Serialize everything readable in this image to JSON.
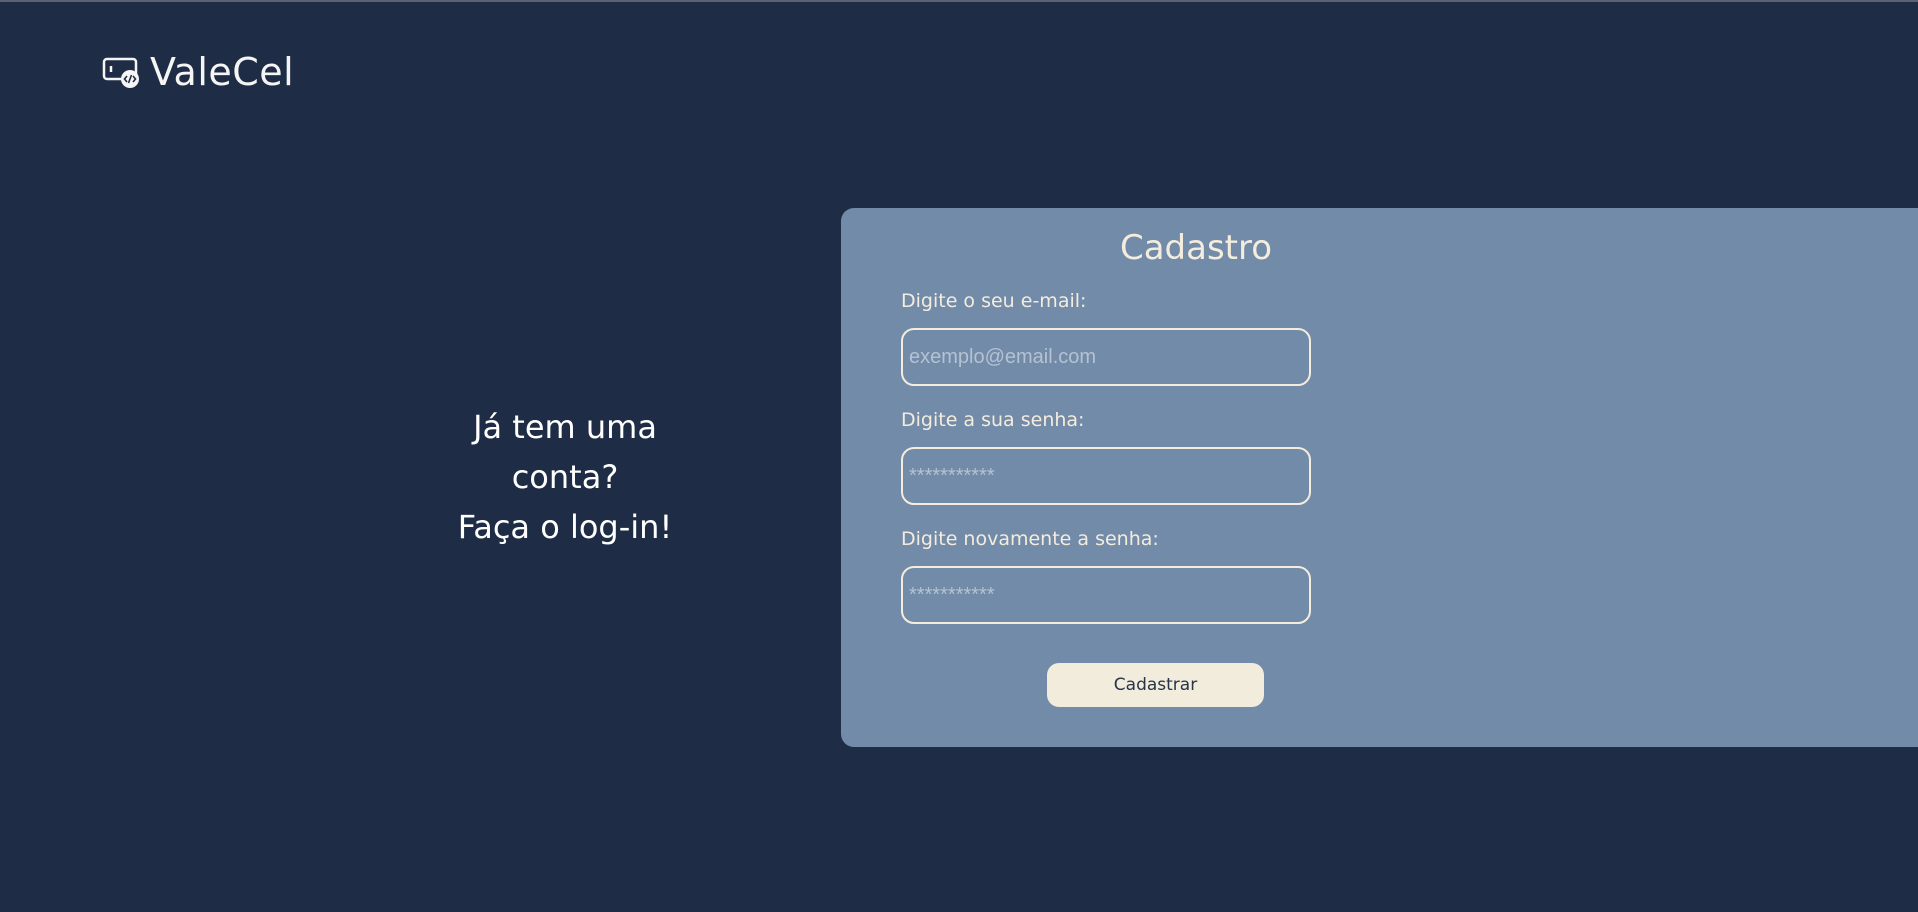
{
  "brand": {
    "name": "ValeCel",
    "icon": "phone-code-icon"
  },
  "login_cta": {
    "line1": "Já tem uma",
    "line2": "conta?",
    "line3": "Faça o log-in!"
  },
  "form": {
    "title": "Cadastro",
    "email_label": "Digite o seu e-mail:",
    "email_placeholder": "exemplo@email.com",
    "email_value": "",
    "password_label": "Digite a sua senha:",
    "password_placeholder": "***********",
    "password_value": "",
    "confirm_label": "Digite novamente a senha:",
    "confirm_placeholder": "***********",
    "confirm_value": "",
    "submit_label": "Cadastrar"
  },
  "colors": {
    "background": "#1e2d45",
    "panel": "#728ba9",
    "cream": "#f4ecdc"
  }
}
